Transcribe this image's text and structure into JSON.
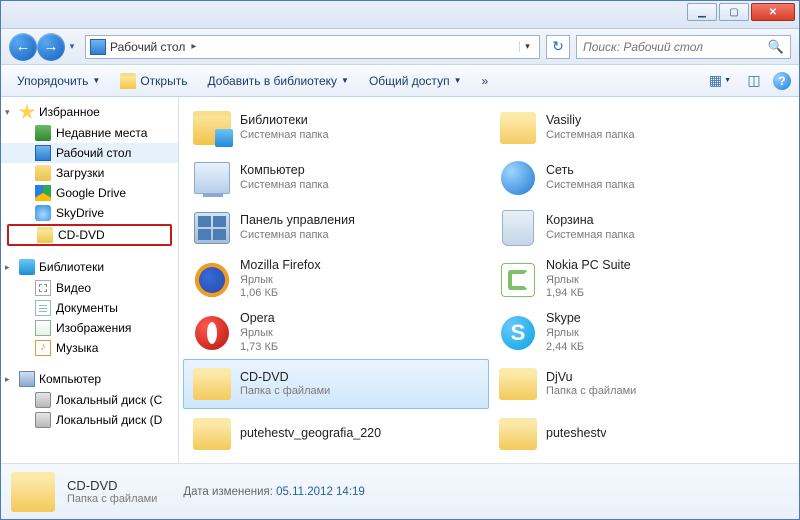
{
  "titlebar": {
    "min": "▁",
    "max": "▢",
    "close": "✕"
  },
  "nav": {
    "address_icon": "desktop",
    "address_text": "Рабочий стол",
    "search_placeholder": "Поиск: Рабочий стол"
  },
  "toolbar": {
    "organize": "Упорядочить",
    "open": "Открыть",
    "addlib": "Добавить в библиотеку",
    "share": "Общий доступ",
    "more": "»"
  },
  "sidebar": {
    "favorites": {
      "label": "Избранное",
      "items": [
        {
          "icon": "i-recent",
          "label": "Недавние места"
        },
        {
          "icon": "i-desktop",
          "label": "Рабочий стол",
          "selected": true
        },
        {
          "icon": "i-downloads",
          "label": "Загрузки"
        },
        {
          "icon": "i-gdrive",
          "label": "Google Drive"
        },
        {
          "icon": "i-skydrive",
          "label": "SkyDrive"
        },
        {
          "icon": "i-folder",
          "label": "CD-DVD",
          "highlighted": true
        }
      ]
    },
    "libraries": {
      "label": "Библиотеки",
      "items": [
        {
          "icon": "i-video",
          "label": "Видео"
        },
        {
          "icon": "i-doc",
          "label": "Документы"
        },
        {
          "icon": "i-img",
          "label": "Изображения"
        },
        {
          "icon": "i-music",
          "label": "Музыка",
          "glyph": "♪"
        }
      ]
    },
    "computer": {
      "label": "Компьютер",
      "items": [
        {
          "icon": "i-disk",
          "label": "Локальный диск (C"
        },
        {
          "icon": "i-disk",
          "label": "Локальный диск (D"
        }
      ]
    }
  },
  "content": {
    "items": [
      {
        "col": 0,
        "icon": "L-libs",
        "name": "Библиотеки",
        "type": "Системная папка"
      },
      {
        "col": 1,
        "icon": "L-userfolder",
        "name": "Vasiliy",
        "type": "Системная папка"
      },
      {
        "col": 0,
        "icon": "L-comp",
        "name": "Компьютер",
        "type": "Системная папка"
      },
      {
        "col": 1,
        "icon": "L-net",
        "name": "Сеть",
        "type": "Системная папка"
      },
      {
        "col": 0,
        "icon": "L-cp",
        "name": "Панель управления",
        "type": "Системная папка"
      },
      {
        "col": 1,
        "icon": "L-bin",
        "name": "Корзина",
        "type": "Системная папка"
      },
      {
        "col": 0,
        "icon": "L-ff",
        "name": "Mozilla Firefox",
        "type": "Ярлык",
        "size": "1,06 КБ"
      },
      {
        "col": 1,
        "icon": "L-nokia",
        "name": "Nokia PC Suite",
        "type": "Ярлык",
        "size": "1,94 КБ"
      },
      {
        "col": 0,
        "icon": "L-opera",
        "name": "Opera",
        "type": "Ярлык",
        "size": "1,73 КБ"
      },
      {
        "col": 1,
        "icon": "L-skype",
        "name": "Skype",
        "type": "Ярлык",
        "size": "2,44 КБ",
        "glyph": "S"
      },
      {
        "col": 0,
        "icon": "L-folder",
        "name": "CD-DVD",
        "type": "Папка с файлами",
        "selected": true
      },
      {
        "col": 1,
        "icon": "L-folder",
        "name": "DjVu",
        "type": "Папка с файлами"
      },
      {
        "col": 0,
        "icon": "L-folder",
        "name": "putehestv_geografia_220",
        "type": ""
      },
      {
        "col": 1,
        "icon": "L-folder",
        "name": "puteshestv",
        "type": ""
      }
    ]
  },
  "details": {
    "name": "CD-DVD",
    "type": "Папка с файлами",
    "mod_label": "Дата изменения:",
    "mod_value": "05.11.2012 14:19"
  }
}
